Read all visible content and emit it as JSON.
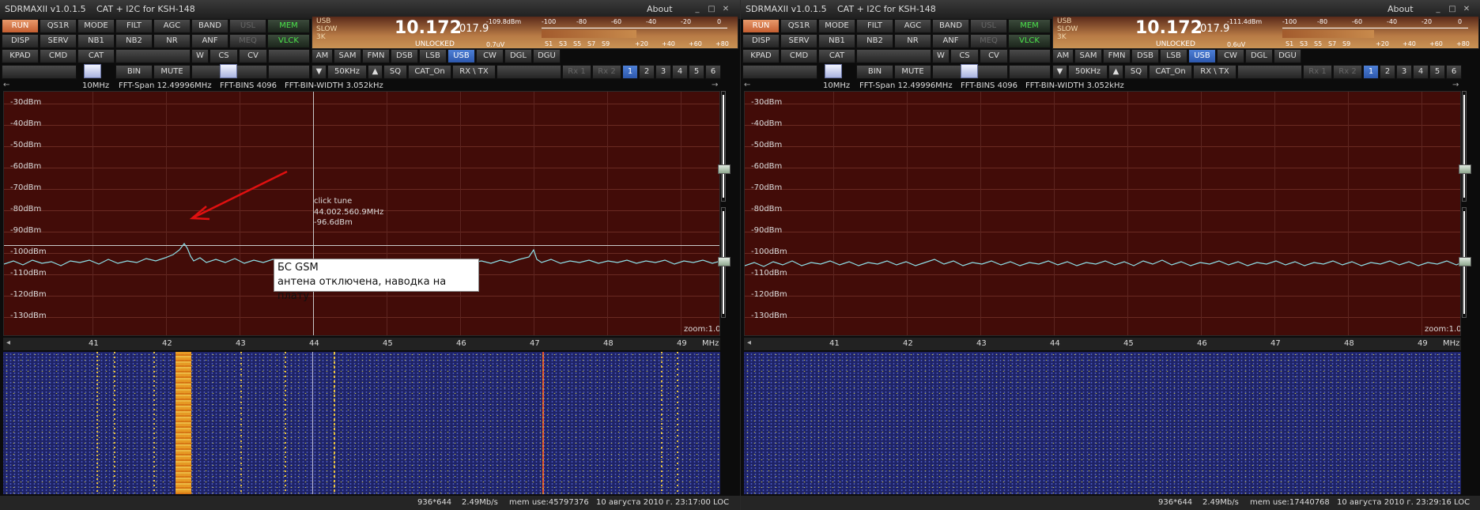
{
  "app": {
    "title": "SDRMAXII v1.0.1.5",
    "connection": "CAT + I2C for KSH-148",
    "about": "About"
  },
  "buttons": {
    "row1": [
      "RUN",
      "QS1R",
      "MODE",
      "FILT",
      "AGC",
      "BAND",
      "USL",
      "MEM"
    ],
    "row2": [
      "DISP",
      "SERV",
      "NB1",
      "NB2",
      "NR",
      "ANF",
      "MEQ",
      "VLCK"
    ],
    "row3": [
      "KPAD",
      "CMD",
      "CAT",
      "W",
      "CS",
      "CV"
    ],
    "modes": [
      "AM",
      "SAM",
      "FMN",
      "DSB",
      "LSB",
      "USB",
      "CW",
      "DGL",
      "DGU"
    ],
    "row4": [
      "BIN",
      "MUTE",
      "50KHz",
      "SQ",
      "CAT_On",
      "RX \\ TX"
    ],
    "rx": [
      "Rx 1",
      "Rx 2"
    ],
    "pages": [
      "1",
      "2",
      "3",
      "4",
      "5",
      "6"
    ]
  },
  "colors": {
    "accent_orange": "#d87a48",
    "active_blue": "#3a6ac4",
    "green_text": "#4be24b",
    "spectrum_bg": "#420c08",
    "trace": "#8ee0e8",
    "waterfall_bg": "#1e2366"
  },
  "display": {
    "mode_lines": [
      "USB",
      "SLOW",
      "3K"
    ],
    "freq_main": "10.172",
    "freq_sub": "017.9",
    "status": "UNLOCKED",
    "smeter_top": [
      "-100",
      "-80",
      "-60",
      "-40",
      "-20",
      "0"
    ],
    "smeter_bot": [
      "S1",
      "S3",
      "S5",
      "S7",
      "S9",
      "+20",
      "+40",
      "+60",
      "+80"
    ]
  },
  "fft_info": {
    "center": "10MHz",
    "span": "FFT-Span 12.49996MHz",
    "bins": "FFT-BINS 4096",
    "bin_width": "FFT-BIN-WIDTH 3.052kHz"
  },
  "db_labels": [
    "-30dBm",
    "-40dBm",
    "-50dBm",
    "-60dBm",
    "-70dBm",
    "-80dBm",
    "-90dBm",
    "-100dBm",
    "-110dBm",
    "-120dBm",
    "-130dBm"
  ],
  "zoom": "zoom:1.00",
  "freq_ticks": [
    "41",
    "42",
    "43",
    "44",
    "45",
    "46",
    "47",
    "48",
    "49"
  ],
  "freq_unit": "MHz",
  "windows": [
    {
      "dbm_readout": "-109.8dBm",
      "uv_readout": "0.7uV",
      "annotation": {
        "line1": "БС GSM",
        "line2": "антена отключена, наводка на плату"
      },
      "tune": {
        "title": "click tune",
        "freq": "44.002.560.9MHz",
        "db": "-96.6dBm"
      },
      "status": {
        "size": "936*644",
        "rate": "2.49Mb/s",
        "mem": "mem use:45797376",
        "date": "10 августа 2010 г. 23:17:00 LOC"
      }
    },
    {
      "dbm_readout": "-111.4dBm",
      "uv_readout": "0.6uV",
      "status": {
        "size": "936*644",
        "rate": "2.49Mb/s",
        "mem": "mem use:17440768",
        "date": "10 августа 2010 г. 23:29:16 LOC"
      }
    }
  ]
}
